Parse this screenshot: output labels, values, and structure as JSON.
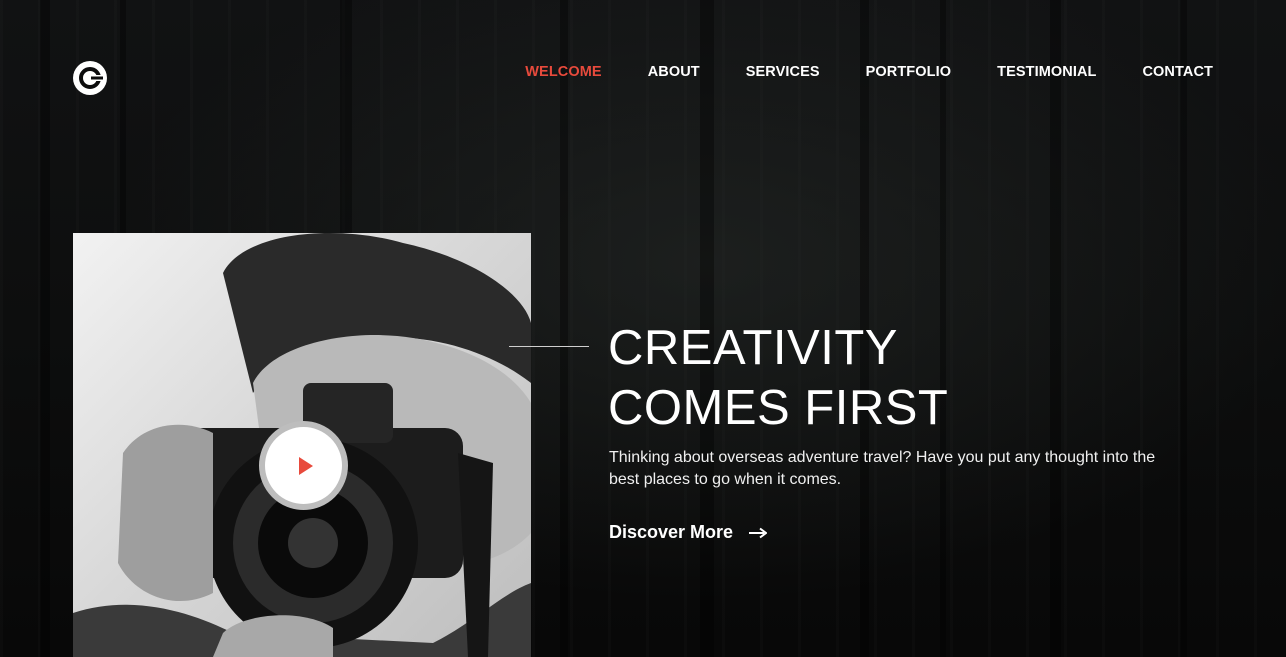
{
  "brand": {
    "logo": "c-circle-logo-icon"
  },
  "nav": {
    "items": [
      {
        "label": "WELCOME",
        "active": true
      },
      {
        "label": "ABOUT",
        "active": false
      },
      {
        "label": "SERVICES",
        "active": false
      },
      {
        "label": "PORTFOLIO",
        "active": false
      },
      {
        "label": "TESTIMONIAL",
        "active": false
      },
      {
        "label": "CONTACT",
        "active": false
      }
    ]
  },
  "hero": {
    "title_line1": "CREATIVITY",
    "title_line2": "COMES FIRST",
    "description": "Thinking about overseas adventure travel? Have you put any thought into the best places to go when it comes.",
    "cta_label": "Discover More",
    "cta_icon": "arrow-right-icon",
    "play_icon": "play-icon"
  },
  "colors": {
    "accent": "#e84a3c",
    "background": "#0c0c0d",
    "text": "#ffffff"
  }
}
